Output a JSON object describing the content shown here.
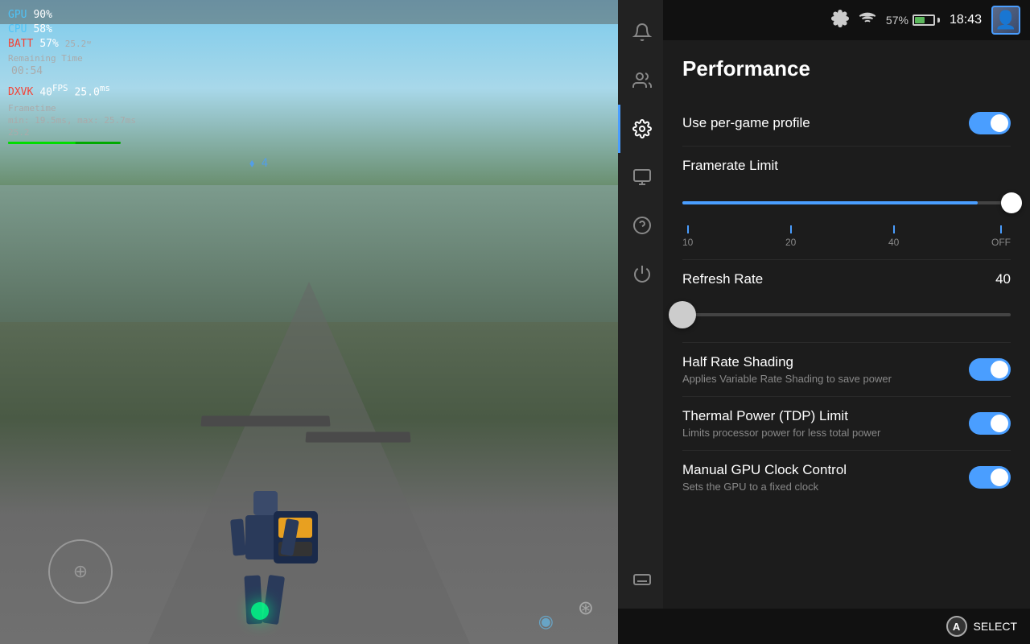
{
  "game": {
    "hud": {
      "gpu_label": "GPU",
      "gpu_value": "90%",
      "cpu_label": "CPU",
      "cpu_value": "58%",
      "batt_label": "BATT",
      "batt_value": "57%",
      "batt_power": "25.2ᵂ",
      "batt_remaining_label": "Remaining Time",
      "batt_time": "00:54",
      "dxvk_label": "DXVK",
      "dxvk_fps": "40",
      "dxvk_ms": "25.0ᵐˢ",
      "frametime_label": "Frametime",
      "frametime_detail": "min: 19.5ms, max: 25.7ms",
      "frametime_value": "25.2"
    }
  },
  "topbar": {
    "battery_percent": "57%",
    "time": "18:43"
  },
  "sidebar": {
    "items": [
      {
        "id": "notifications",
        "icon": "bell"
      },
      {
        "id": "users",
        "icon": "users"
      },
      {
        "id": "settings",
        "icon": "gear"
      },
      {
        "id": "display",
        "icon": "display"
      },
      {
        "id": "help",
        "icon": "question"
      },
      {
        "id": "power",
        "icon": "power"
      },
      {
        "id": "keyboard",
        "icon": "keyboard"
      }
    ]
  },
  "performance": {
    "title": "Performance",
    "per_game_profile": {
      "label": "Use per-game profile",
      "enabled": true
    },
    "framerate_limit": {
      "label": "Framerate Limit",
      "value": "OFF",
      "ticks": [
        {
          "label": "10",
          "position": "0%"
        },
        {
          "label": "20",
          "position": "33%"
        },
        {
          "label": "40",
          "position": "66%"
        },
        {
          "label": "OFF",
          "position": "100%"
        }
      ]
    },
    "refresh_rate": {
      "label": "Refresh Rate",
      "value": "40"
    },
    "half_rate_shading": {
      "label": "Half Rate Shading",
      "sublabel": "Applies Variable Rate Shading to save power",
      "enabled": true
    },
    "tdp_limit": {
      "label": "Thermal Power (TDP) Limit",
      "sublabel": "Limits processor power for less total power",
      "enabled": true
    },
    "manual_gpu": {
      "label": "Manual GPU Clock Control",
      "sublabel": "Sets the GPU to a fixed clock",
      "enabled": true
    }
  },
  "bottombar": {
    "a_label": "A",
    "select_label": "SELECT"
  }
}
